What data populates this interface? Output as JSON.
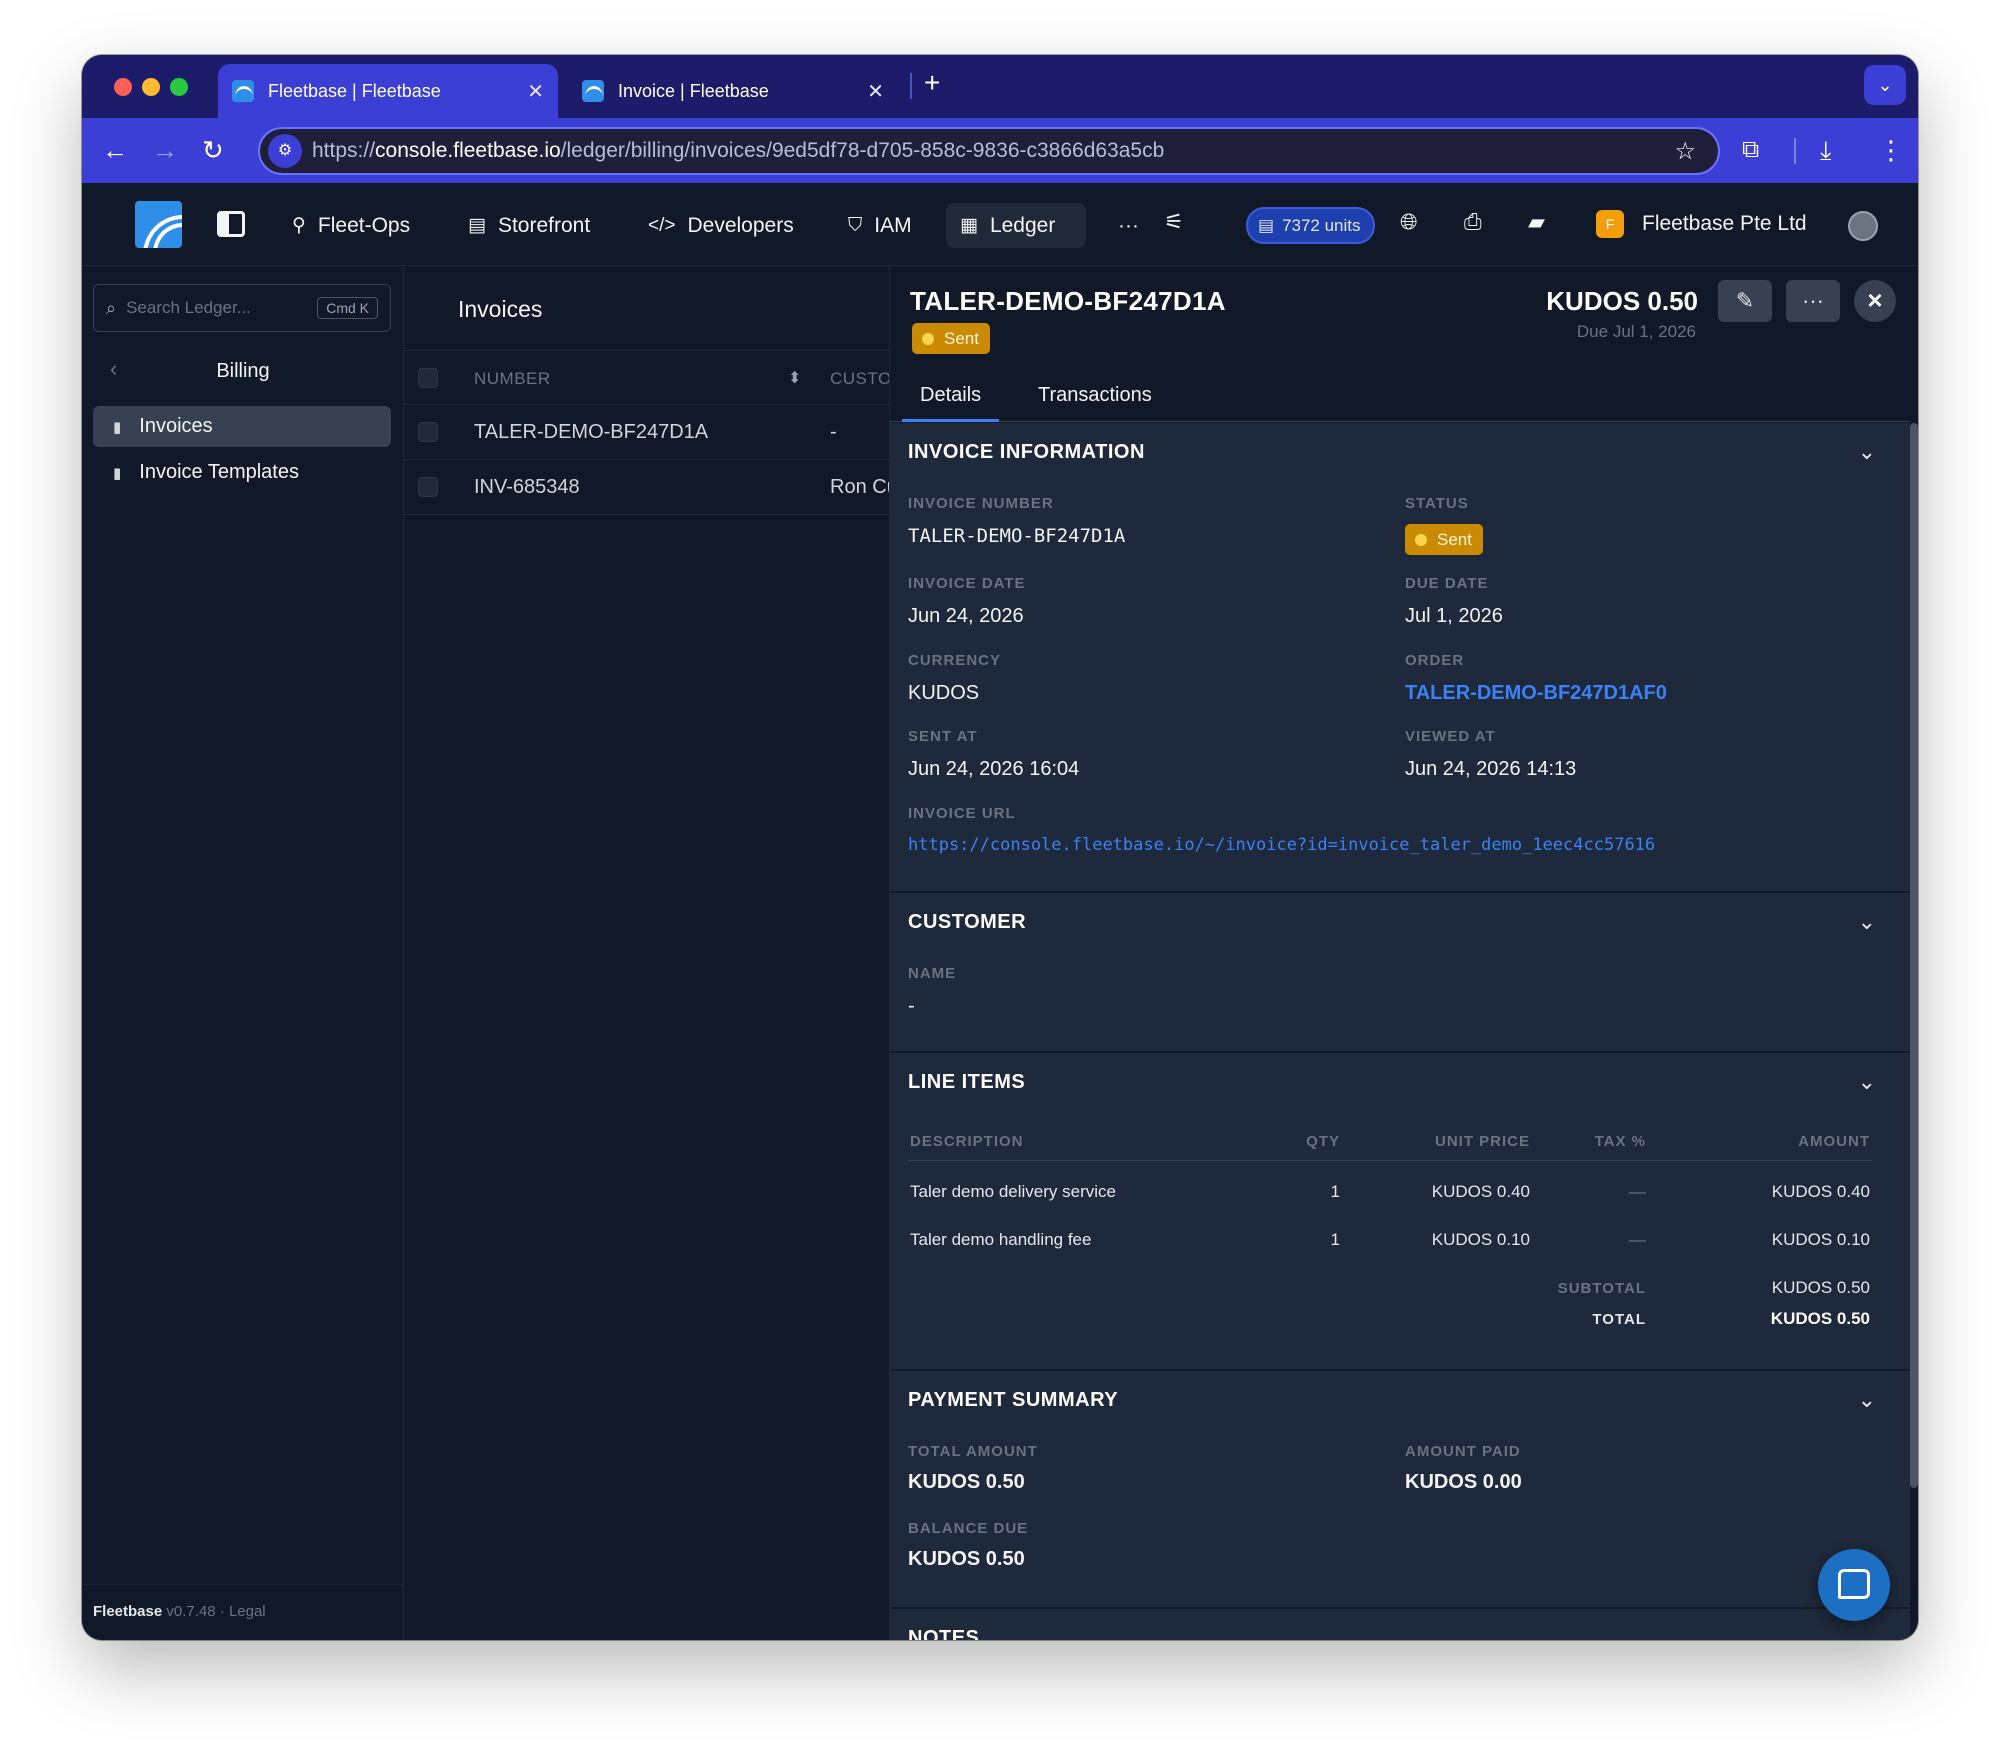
{
  "browser": {
    "tabs": [
      {
        "title": "Fleetbase | Fleetbase",
        "active": true
      },
      {
        "title": "Invoice | Fleetbase",
        "active": false
      }
    ],
    "new_tab": "+",
    "url_scheme": "https://",
    "url_host": "console.fleetbase.io",
    "url_path": "/ledger/billing/invoices/9ed5df78-d705-858c-9836-c3866d63a5cb"
  },
  "header": {
    "nav": [
      {
        "label": "Fleet-Ops",
        "icon": "route-icon"
      },
      {
        "label": "Storefront",
        "icon": "store-icon"
      },
      {
        "label": "Developers",
        "icon": "code-icon"
      },
      {
        "label": "IAM",
        "icon": "shield-icon"
      },
      {
        "label": "Ledger",
        "icon": "ledger-icon",
        "active": true
      }
    ],
    "more": "···",
    "units": "7372 units",
    "org_initial": "F",
    "org_name": "Fleetbase Pte Ltd"
  },
  "sidebar": {
    "search_placeholder": "Search Ledger...",
    "search_shortcut": "Cmd K",
    "section_title": "Billing",
    "items": [
      {
        "label": "Invoices",
        "active": true
      },
      {
        "label": "Invoice Templates",
        "active": false
      }
    ],
    "footer_brand": "Fleetbase",
    "footer_version": "v0.7.48",
    "footer_sep": "·",
    "footer_legal": "Legal"
  },
  "list": {
    "title": "Invoices",
    "columns": [
      "NUMBER",
      "CUSTOMER"
    ],
    "rows": [
      {
        "number": "TALER-DEMO-BF247D1A",
        "customer": "-"
      },
      {
        "number": "INV-685348",
        "customer": "Ron Customer"
      }
    ]
  },
  "detail": {
    "title": "TALER-DEMO-BF247D1A",
    "status": "Sent",
    "amount": "KUDOS 0.50",
    "due": "Due Jul 1, 2026",
    "tabs": [
      "Details",
      "Transactions"
    ],
    "invoice_info": {
      "title": "INVOICE INFORMATION",
      "invoice_number_label": "INVOICE NUMBER",
      "invoice_number": "TALER-DEMO-BF247D1A",
      "status_label": "STATUS",
      "status": "Sent",
      "invoice_date_label": "INVOICE DATE",
      "invoice_date": "Jun 24, 2026",
      "due_date_label": "DUE DATE",
      "due_date": "Jul 1, 2026",
      "currency_label": "CURRENCY",
      "currency": "KUDOS",
      "order_label": "ORDER",
      "order": "TALER-DEMO-BF247D1AF0",
      "sent_at_label": "SENT AT",
      "sent_at": "Jun 24, 2026 16:04",
      "viewed_at_label": "VIEWED AT",
      "viewed_at": "Jun 24, 2026 14:13",
      "invoice_url_label": "INVOICE URL",
      "invoice_url": "https://console.fleetbase.io/~/invoice?id=invoice_taler_demo_1eec4cc57616"
    },
    "customer": {
      "title": "CUSTOMER",
      "name_label": "NAME",
      "name": "-"
    },
    "line_items": {
      "title": "LINE ITEMS",
      "columns": [
        "DESCRIPTION",
        "QTY",
        "UNIT PRICE",
        "TAX %",
        "AMOUNT"
      ],
      "rows": [
        {
          "description": "Taler demo delivery service",
          "qty": "1",
          "unit_price": "KUDOS 0.40",
          "tax": "—",
          "amount": "KUDOS 0.40"
        },
        {
          "description": "Taler demo handling fee",
          "qty": "1",
          "unit_price": "KUDOS 0.10",
          "tax": "—",
          "amount": "KUDOS 0.10"
        }
      ],
      "subtotal_label": "SUBTOTAL",
      "subtotal": "KUDOS 0.50",
      "total_label": "TOTAL",
      "total": "KUDOS 0.50"
    },
    "payment_summary": {
      "title": "PAYMENT SUMMARY",
      "total_amount_label": "TOTAL AMOUNT",
      "total_amount": "KUDOS 0.50",
      "amount_paid_label": "AMOUNT PAID",
      "amount_paid": "KUDOS 0.00",
      "balance_due_label": "BALANCE DUE",
      "balance_due": "KUDOS 0.50"
    },
    "next_section_partial": "NOTES"
  },
  "colors": {
    "accent": "#3b82f6",
    "status_sent": "#ca8a04",
    "browser_chrome": "#3b3fd6"
  }
}
